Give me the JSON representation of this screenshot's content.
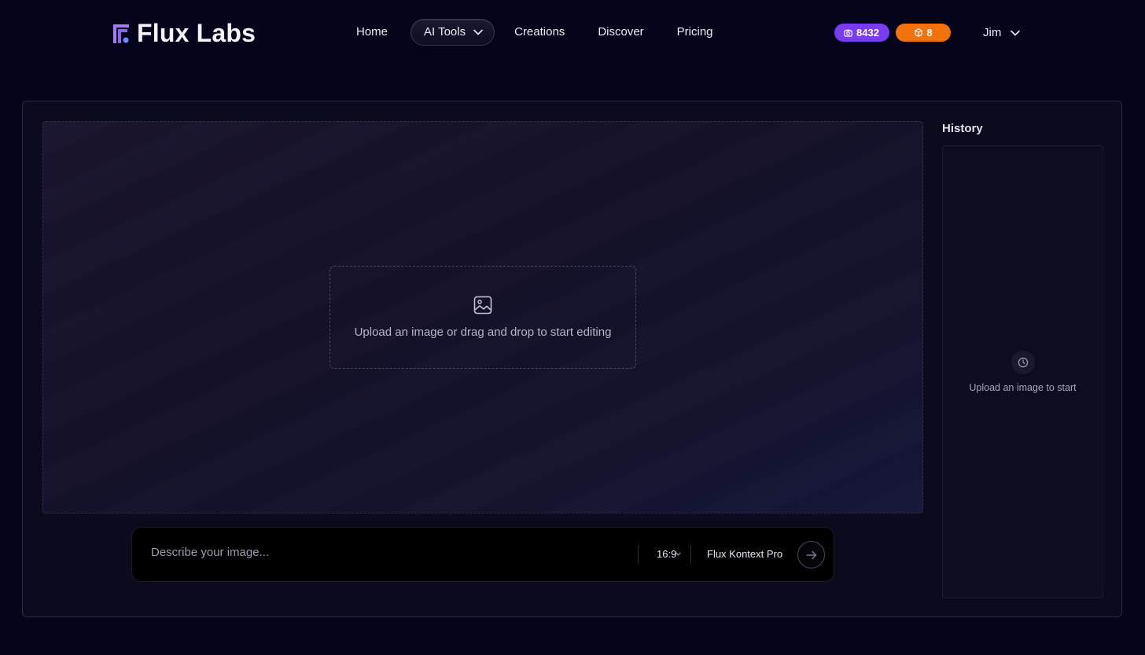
{
  "brand": {
    "name": "Flux Labs"
  },
  "nav": {
    "items": [
      {
        "label": "Home"
      },
      {
        "label": "AI Tools"
      },
      {
        "label": "Creations"
      },
      {
        "label": "Discover"
      },
      {
        "label": "Pricing"
      }
    ]
  },
  "badges": {
    "credits": "8432",
    "gems": "8"
  },
  "user": {
    "name": "Jim"
  },
  "editor": {
    "upload_text": "Upload an image or drag and drop to start editing"
  },
  "history": {
    "title": "History",
    "empty_text": "Upload an image to start"
  },
  "prompt": {
    "placeholder": "Describe your image...",
    "ratio": "16:9",
    "model": "Flux Kontext Pro"
  },
  "colors": {
    "background": "#05041a",
    "credits_badge": "#7a3cf0",
    "gems_badge": "#f2720d",
    "logo_accent": "#a47cf5"
  }
}
